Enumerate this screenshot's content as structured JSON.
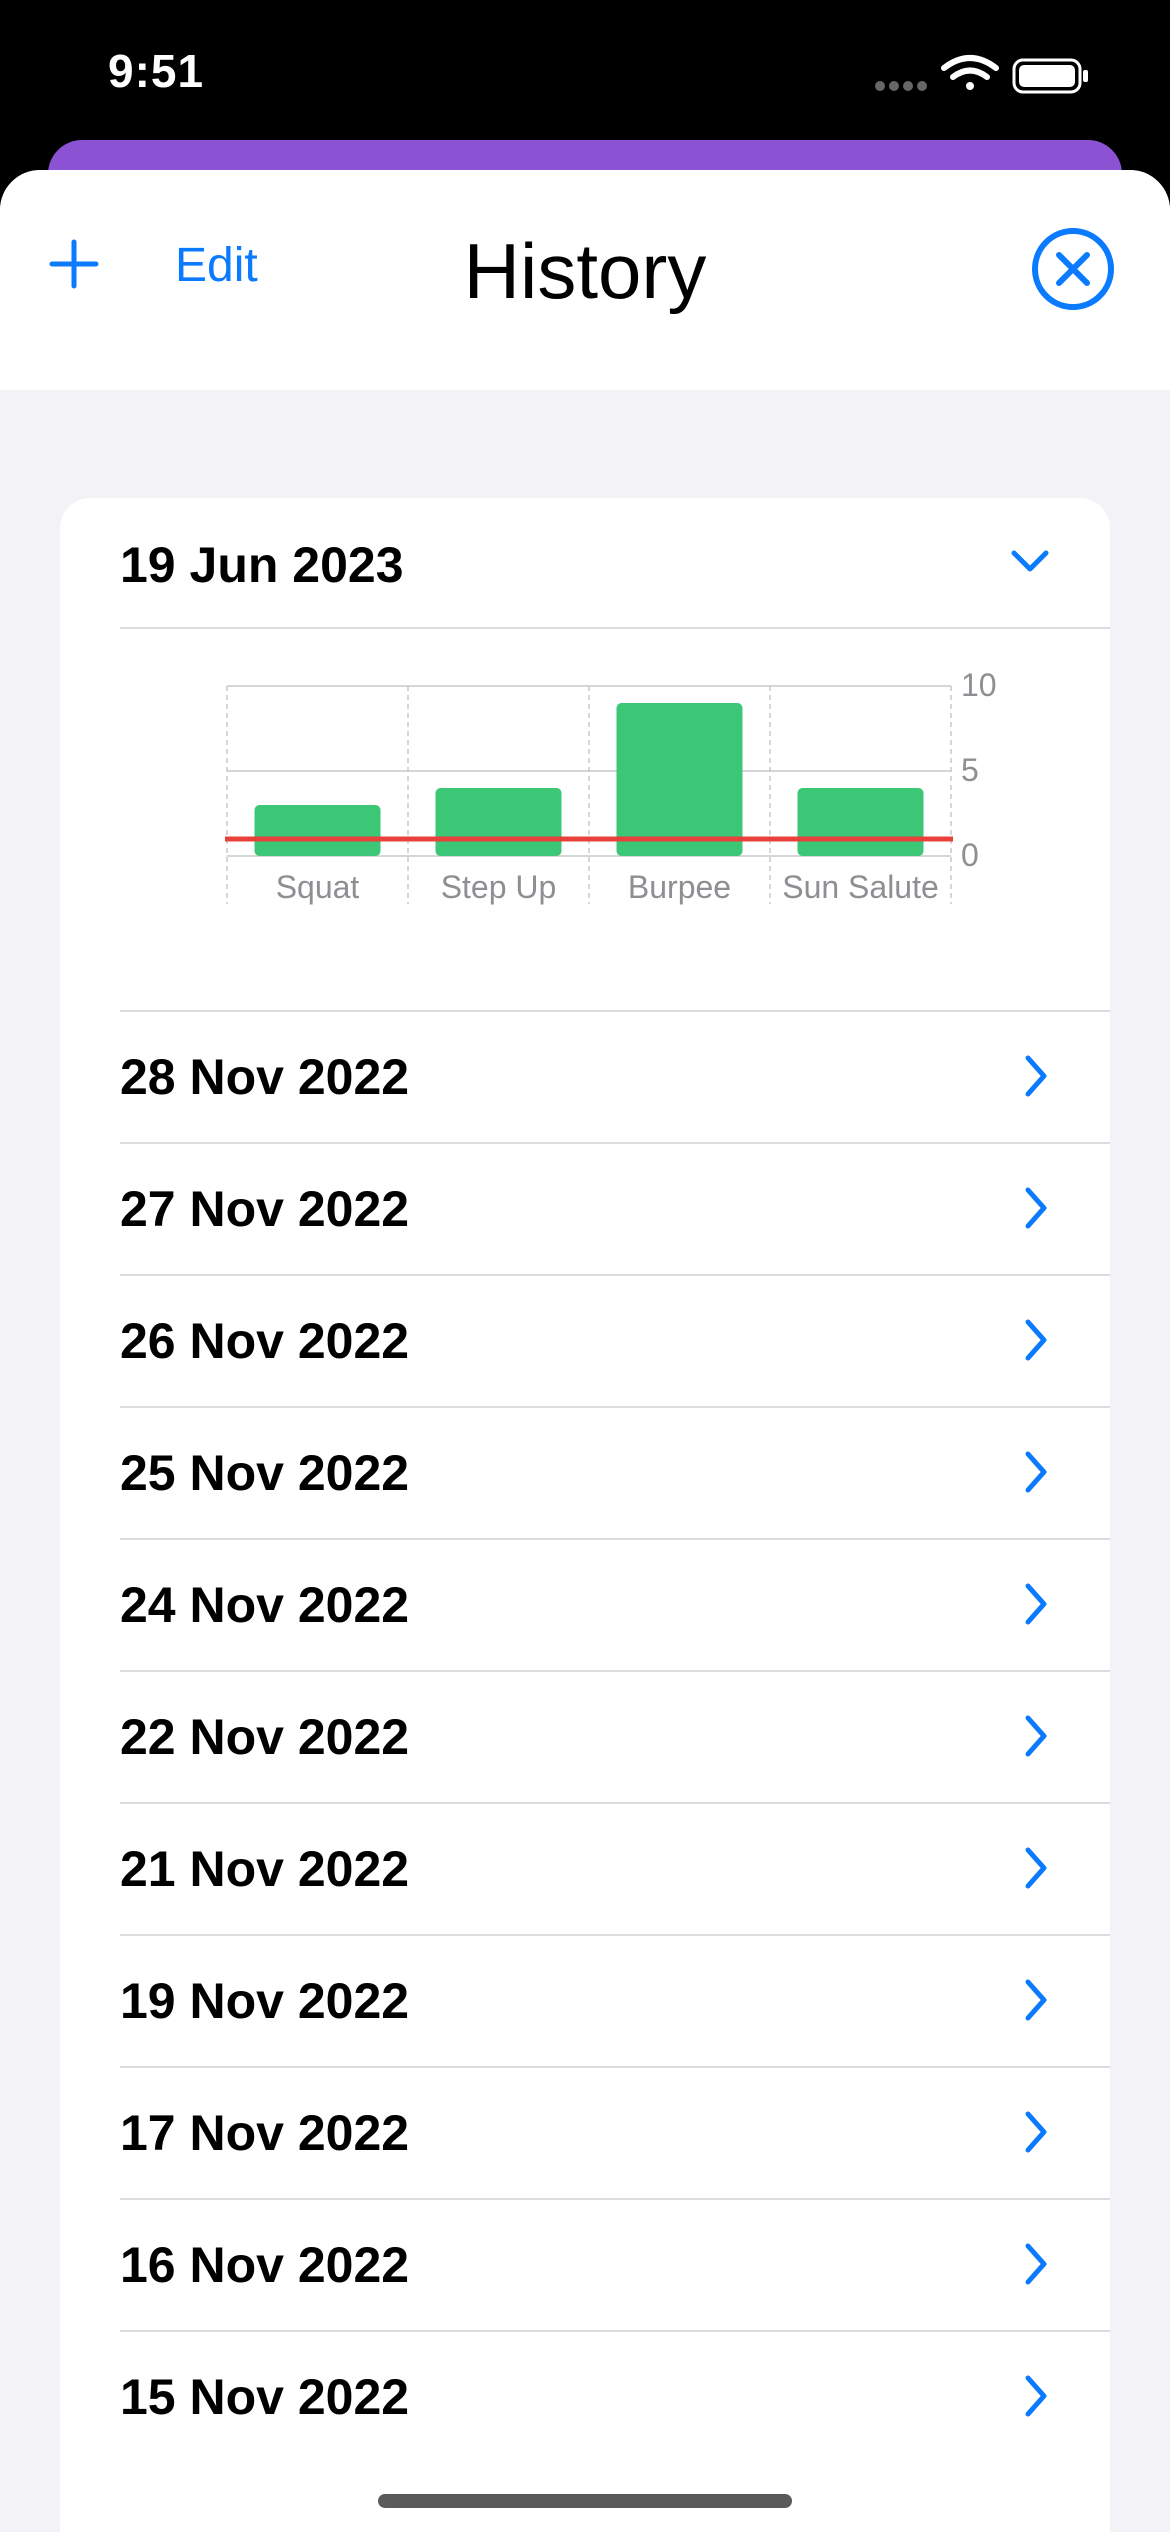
{
  "status_bar": {
    "time": "9:51"
  },
  "navbar": {
    "title": "History",
    "edit_label": "Edit"
  },
  "expanded_entry": {
    "date": "19 Jun 2023",
    "chart_data": {
      "type": "bar",
      "categories": [
        "Squat",
        "Step Up",
        "Burpee",
        "Sun Salute"
      ],
      "values": [
        3,
        4,
        9,
        4
      ],
      "ylim": [
        0,
        10
      ],
      "yticks": [
        "0",
        "5",
        "10"
      ],
      "reference_line": 1,
      "bar_color": "#3CC777",
      "line_color": "#E8403A"
    }
  },
  "entries": [
    {
      "date": "28 Nov 2022"
    },
    {
      "date": "27 Nov 2022"
    },
    {
      "date": "26 Nov 2022"
    },
    {
      "date": "25 Nov 2022"
    },
    {
      "date": "24 Nov 2022"
    },
    {
      "date": "22 Nov 2022"
    },
    {
      "date": "21 Nov 2022"
    },
    {
      "date": "19 Nov 2022"
    },
    {
      "date": "17 Nov 2022"
    },
    {
      "date": "16 Nov 2022"
    },
    {
      "date": "15 Nov 2022"
    }
  ],
  "colors": {
    "accent": "#0A7AFF",
    "header_band": "#8B52D4",
    "background": "#F2F2F7"
  }
}
